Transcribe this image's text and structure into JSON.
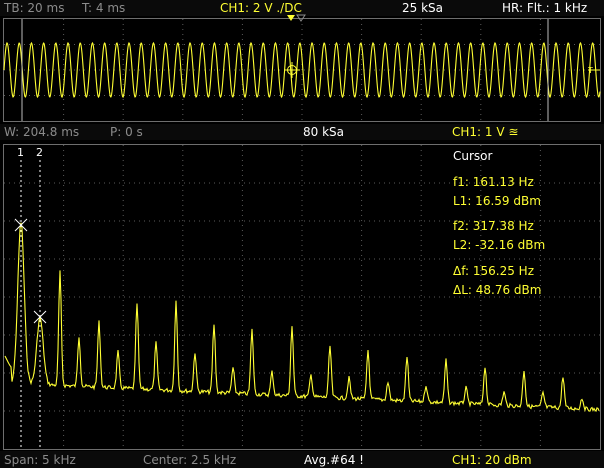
{
  "colors": {
    "trace": "#ffff33",
    "accent": "#ffff33",
    "grid": "#6e6e6e",
    "text": "#ffffff",
    "muted": "#8c8c8c"
  },
  "top_bar": {
    "timebase": "TB: 20 ms",
    "trigger_time": "T: 4 ms",
    "channel": "CH1: 2 V ./DC",
    "sample_rate": "25 kSa",
    "high_res": "HR: Flt.: 1 kHz"
  },
  "mid_bar": {
    "window": "W: 204.8 ms",
    "position": "P: 0 s",
    "fft_samples": "80 kSa",
    "fft_channel": "CH1: 1 V ≊"
  },
  "cursor_markers": {
    "c1": "1",
    "c2": "2"
  },
  "cursor_panel": {
    "title": "Cursor",
    "f1": "f1: 161.13 Hz",
    "l1": "L1: 16.59 dBm",
    "f2": "f2: 317.38 Hz",
    "l2": "L2: -32.16 dBm",
    "df": "Δf: 156.25 Hz",
    "dl": "ΔL: 48.76 dBm"
  },
  "bottom_bar": {
    "span": "Span: 5 kHz",
    "center": "Center: 2.5 kHz",
    "averages": "Avg.#64 !",
    "fft_scale": "CH1: 20 dBm"
  },
  "icons": [
    "trigger-marker-icon",
    "trigger-level-icon",
    "crosshair-icon",
    "cursor-cross-icon"
  ]
}
